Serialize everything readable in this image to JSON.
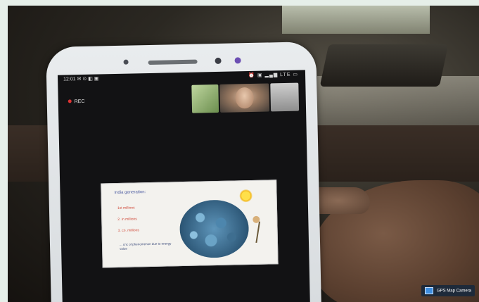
{
  "phone_screen": {
    "status_time": "12:01 ✉ ⊙ ◧ ▣",
    "status_icons": "⏰ ▣ ▂▄▆ LTE ▭",
    "rec_label": "REC"
  },
  "slide": {
    "title": "India generation:",
    "items": [
      "1st millions",
      "2. in millions",
      "3. co. millions"
    ],
    "note": "... cnc of phenomenon due to energy value"
  },
  "watermark": {
    "label": "GPS Map Camera"
  },
  "colors": {
    "screen_bg": "#121214",
    "slide_title": "#4a5aa0",
    "slide_items": "#d04a3a",
    "watermark_bg": "#1e2a3a"
  },
  "icons": [
    "record-dot-icon",
    "watermark-camera-icon"
  ]
}
